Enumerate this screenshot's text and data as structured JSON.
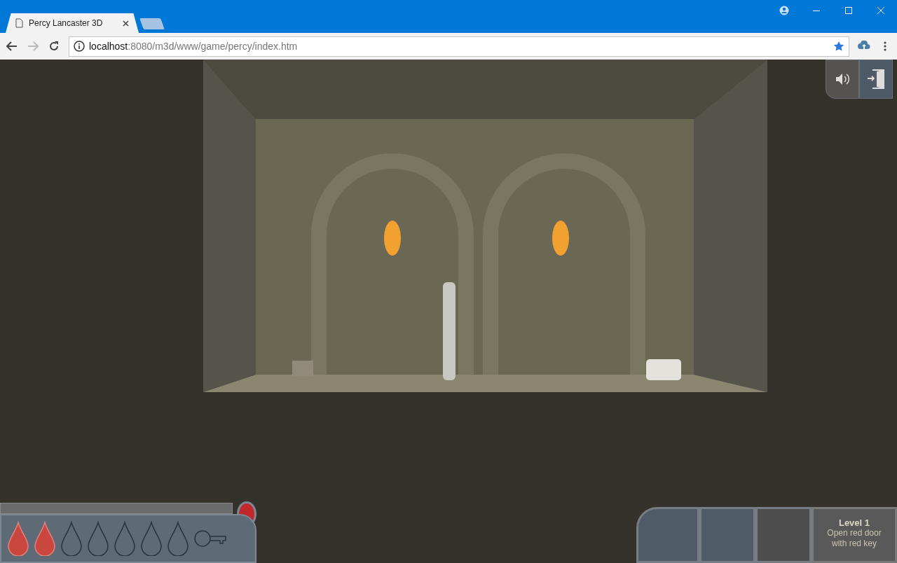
{
  "browser": {
    "tab": {
      "title": "Percy Lancaster 3D",
      "selected": true
    },
    "url": {
      "host": "localhost",
      "path": ":8080/m3d/www/game/percy/index.htm"
    },
    "bookmarked": true
  },
  "game": {
    "sound_on": true,
    "health": [
      {
        "filled": true
      },
      {
        "filled": true
      },
      {
        "filled": false
      },
      {
        "filled": false
      },
      {
        "filled": false
      },
      {
        "filled": false
      },
      {
        "filled": false
      }
    ],
    "key_collected": false,
    "level": {
      "title": "Level 1",
      "objective": "Open red door with red key"
    }
  }
}
